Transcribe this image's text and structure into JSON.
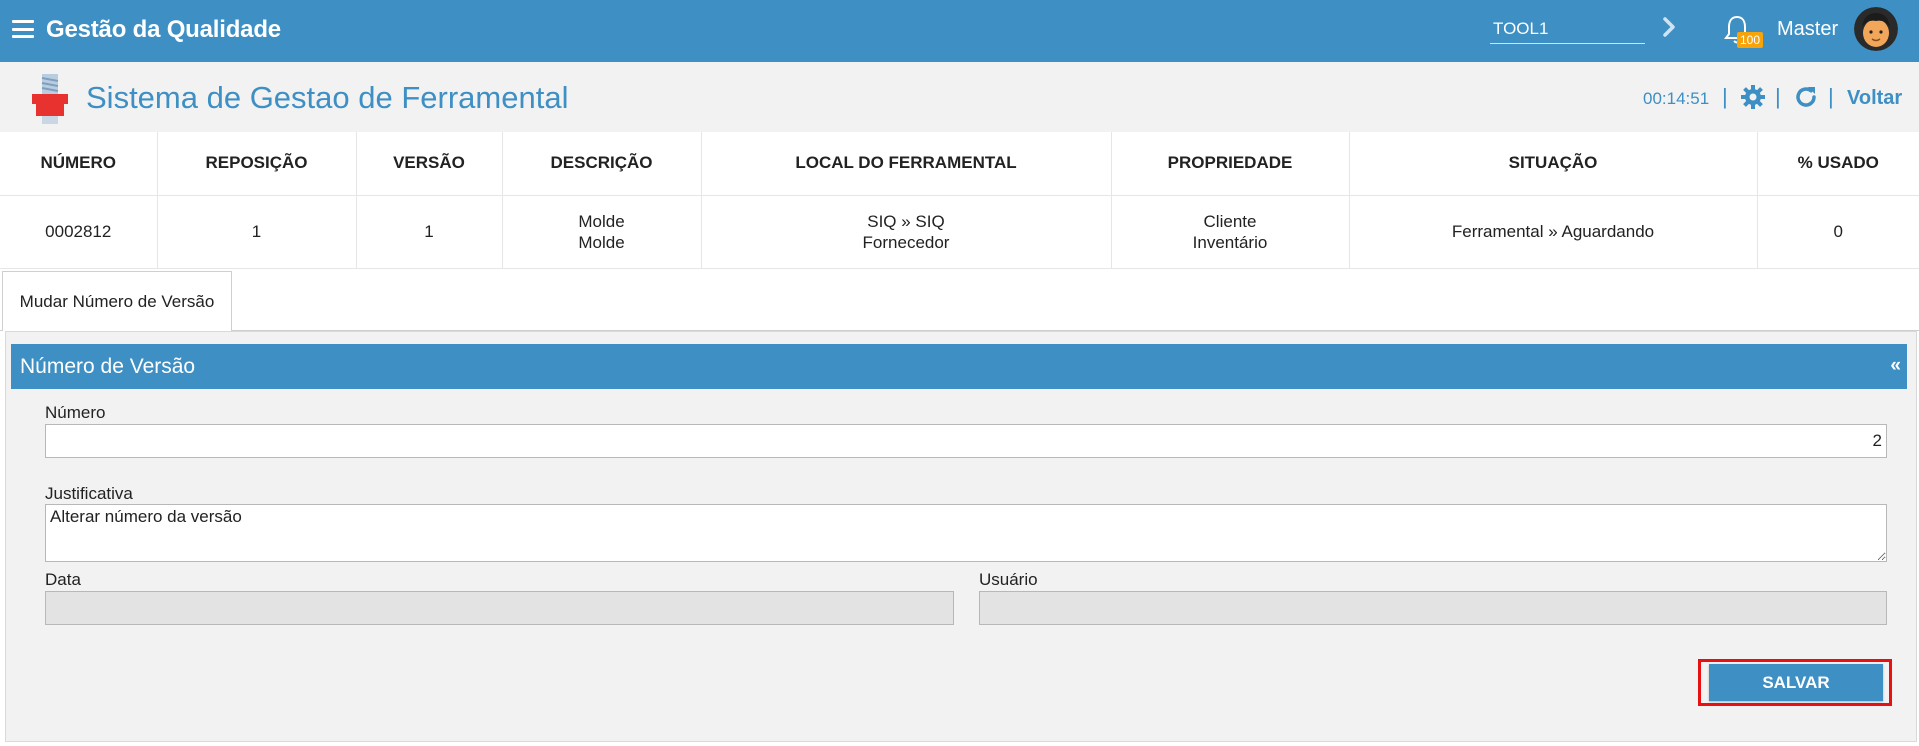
{
  "topbar": {
    "app_title": "Gestão da Qualidade",
    "search_value": "TOOL1",
    "notification_count": "100",
    "user_name": "Master"
  },
  "header": {
    "title": "Sistema de Gestao de Ferramental",
    "clock": "00:14:51",
    "separator": "|",
    "back_label": "Voltar"
  },
  "table": {
    "columns": [
      "NÚMERO",
      "REPOSIÇÃO",
      "VERSÃO",
      "DESCRIÇÃO",
      "LOCAL DO FERRAMENTAL",
      "PROPRIEDADE",
      "SITUAÇÃO",
      "% USADO"
    ],
    "row": {
      "numero": "0002812",
      "reposicao": "1",
      "versao": "1",
      "descricao_1": "Molde",
      "descricao_2": "Molde",
      "local_1": "SIQ » SIQ",
      "local_2": "Fornecedor",
      "propriedade_1": "Cliente",
      "propriedade_2": "Inventário",
      "situacao": "Ferramental » Aguardando",
      "usado": "0"
    }
  },
  "tabs": [
    {
      "label": "Mudar Número de Versão"
    }
  ],
  "panel": {
    "title": "Número de Versão",
    "collapse_symbol": "«",
    "numero_label": "Número",
    "numero_value": "2",
    "justificativa_label": "Justificativa",
    "justificativa_value": "Alterar número da versão",
    "data_label": "Data",
    "data_value": "",
    "usuario_label": "Usuário",
    "usuario_value": "",
    "save_label": "SALVAR"
  },
  "colors": {
    "primary": "#3d8fc4",
    "badge": "#f7a30a",
    "highlight": "#e81010"
  },
  "icons": [
    "menu-icon",
    "chevron-right-icon",
    "bell-icon",
    "avatar",
    "tool-logo-icon",
    "gear-icon",
    "refresh-icon"
  ]
}
